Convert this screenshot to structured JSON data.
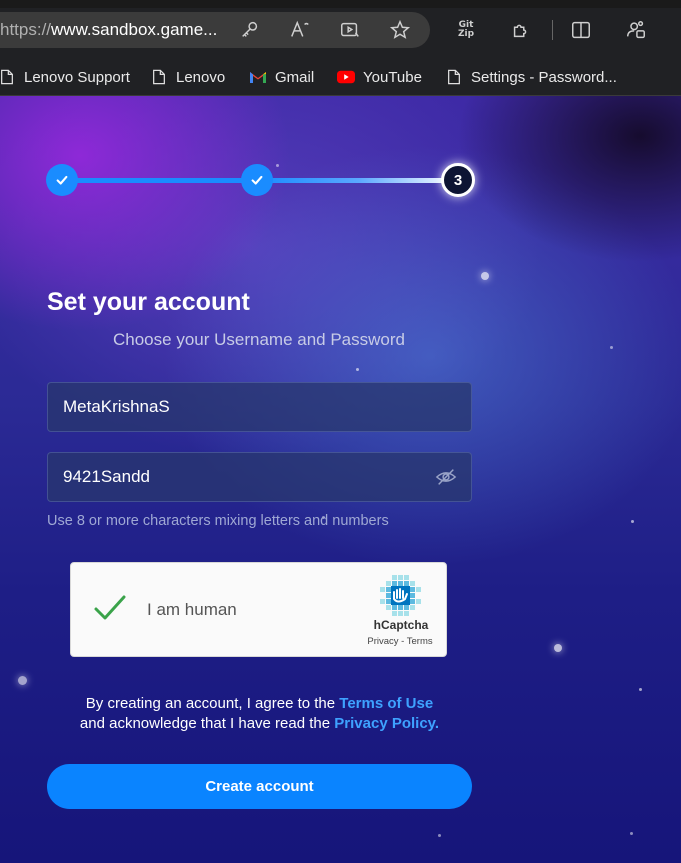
{
  "browser": {
    "url_prefix": "https://",
    "url_main": "www.sandbox.game...",
    "toolbar_icons": [
      "key-icon",
      "read-aloud-icon",
      "media-icon",
      "favorite-star-icon",
      "gitzip-extension-icon",
      "extensions-icon",
      "split-screen-icon",
      "profile-icon"
    ],
    "gitzip_label": "Git Zip",
    "bookmarks": [
      {
        "label": "Lenovo Support",
        "icon": "page-icon"
      },
      {
        "label": "Lenovo",
        "icon": "page-icon"
      },
      {
        "label": "Gmail",
        "icon": "gmail-icon"
      },
      {
        "label": "YouTube",
        "icon": "youtube-icon"
      },
      {
        "label": "Settings - Password...",
        "icon": "page-icon"
      }
    ]
  },
  "stepper": {
    "current_step": "3",
    "total_steps": 3,
    "completed": [
      1,
      2
    ]
  },
  "form": {
    "title": "Set your account",
    "subtitle": "Choose your Username and Password",
    "username_value": "MetaKrishnaS",
    "password_value": "9421Sandd",
    "password_hint": "Use 8 or more characters mixing letters and numbers"
  },
  "captcha": {
    "label": "I am human",
    "brand": "hCaptcha",
    "links": "Privacy - Terms",
    "checked": true
  },
  "legal": {
    "text_1": "By creating an account, I agree to the ",
    "terms_link": "Terms of Use",
    "text_2": "and acknowledge that I have read the ",
    "privacy_link": "Privacy Policy."
  },
  "submit": {
    "label": "Create account"
  },
  "colors": {
    "accent": "#0a84ff",
    "link": "#3ea2ff",
    "step_done": "#1a8cff"
  }
}
